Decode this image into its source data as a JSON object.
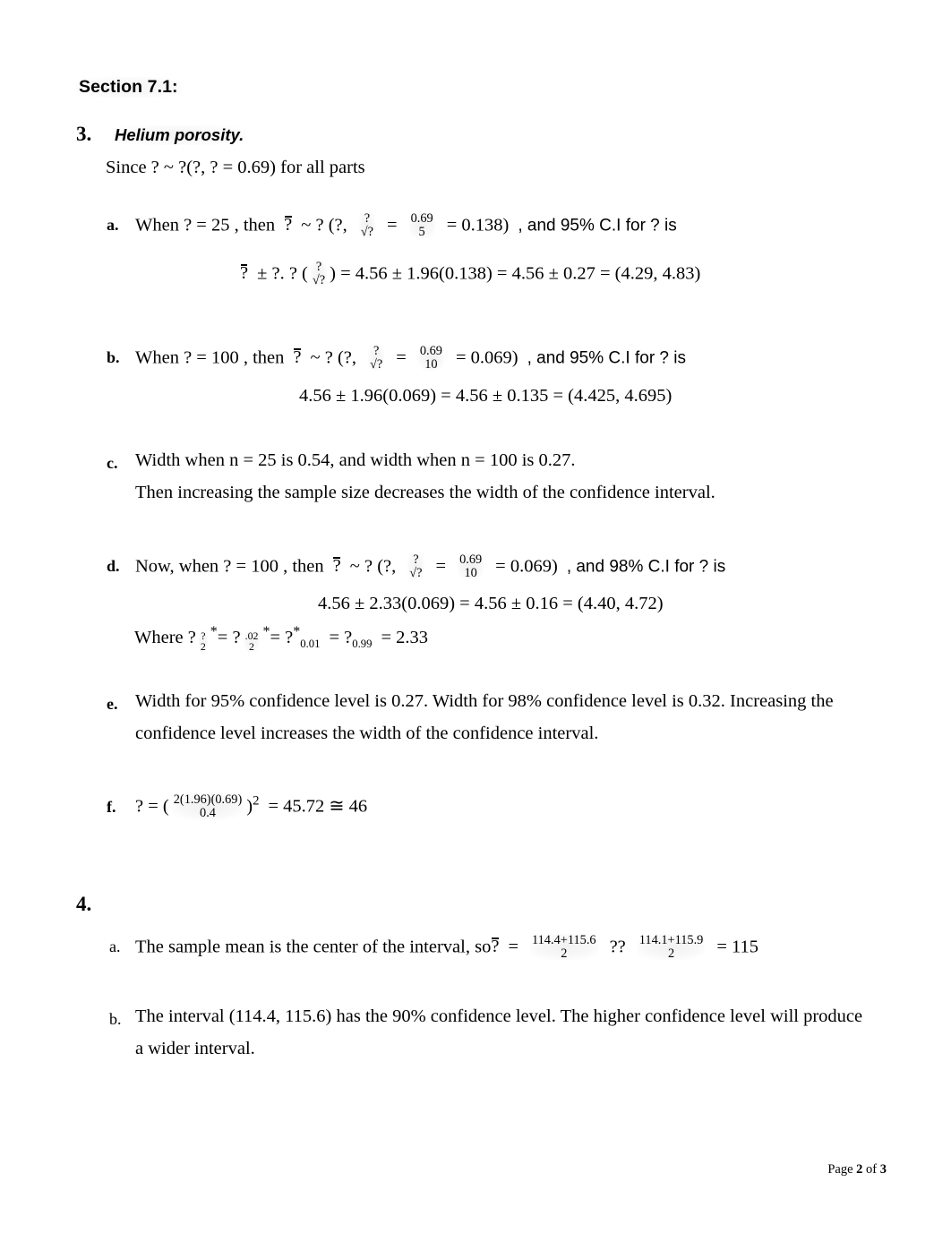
{
  "document": {
    "section_heading": "Section 7.1:",
    "footer": {
      "prefix": "Page ",
      "current_page": "2",
      "middle": " of ",
      "total_pages": "3"
    }
  },
  "problem3": {
    "number": "3.",
    "title": "Helium porosity.",
    "given_line": "Since ? ~ ?(?,     ? = 0.69)    for all parts",
    "items": {
      "a": {
        "label": "a.",
        "line1_pre": "When ? = 25   , then",
        "line1_bar": "?",
        "line1_mid": "~ ? (?,",
        "frac1_num": "?",
        "frac1_den": "√?",
        "eq1": "=",
        "frac2_num": "0.69",
        "frac2_den": "5",
        "eq2": "= 0.138)",
        "line1_post": ", and 95% C.I for ? is",
        "line2_bar": "?",
        "line2_pre": "± ?. ? (",
        "frac3_num": "?",
        "frac3_den": "√?",
        "line2_post": ") = 4.56 ± 1.96(0.138) = 4.56 ± 0.27 = (4.29, 4.83)"
      },
      "b": {
        "label": "b.",
        "line1_pre": "When ? = 100   , then",
        "line1_bar": "?",
        "line1_mid": "~ ? (?,",
        "frac1_num": "?",
        "frac1_den": "√?",
        "eq1": "=",
        "frac2_num": "0.69",
        "frac2_den": "10",
        "eq2": "= 0.069)",
        "line1_post": ", and 95% C.I for ? is",
        "line2": "4.56 ± 1.96(0.069) = 4.56 ± 0.135 = (4.425, 4.695)"
      },
      "c": {
        "label": "c.",
        "line1": "Width when n = 25 is 0.54, and width when n = 100 is 0.27.",
        "line2": "Then increasing the sample size decreases the width of the confidence interval."
      },
      "d": {
        "label": "d.",
        "line1_pre": "Now, when   ? = 100   , then",
        "line1_bar": "?",
        "line1_mid": "~ ? (?,",
        "frac1_num": "?",
        "frac1_den": "√?",
        "eq1": "=",
        "frac2_num": "0.69",
        "frac2_den": "10",
        "eq2": "= 0.069)",
        "line1_post": ", and 98% C.I for ? is",
        "line2": "4.56 ± 2.33(0.069) = 4.56 ± 0.16 = (4.40, 4.72)",
        "where_pre": "Where ?",
        "where_star1": "*",
        "where_sub1_num": "?",
        "where_sub1_den": "2",
        "where_eq1": "=   ?",
        "where_star2": "*",
        "where_sub2_num": ".02",
        "where_sub2_den": "2",
        "where_eq2": "=   ?",
        "where_star3": "*",
        "where_sub3": "0.01",
        "where_eq3": "= ?",
        "where_sub4": "0.99",
        "where_eq4": "= 2.33"
      },
      "e": {
        "label": "e.",
        "line1": "Width for 95% confidence level is 0.27.  Width for 98% confidence level is 0.32.  Increasing the",
        "line2": "confidence level increases the width of the confidence interval."
      },
      "f": {
        "label": "f.",
        "pre": "? = (",
        "frac_num": "2(1.96)(0.69)",
        "frac_den": "0.4",
        "close": ")",
        "exponent": "2",
        "post": "= 45.72 ≅ 46"
      }
    }
  },
  "problem4": {
    "number": "4.",
    "items": {
      "a": {
        "label": "a.",
        "text_pre": "The sample mean is the center of the interval, so",
        "bar_var": "?",
        "eq1": "=",
        "frac1_num": "114.4+115.6",
        "frac1_den": "2",
        "mid": "??",
        "frac2_num": "114.1+115.9",
        "frac2_den": "2",
        "eq2": "= 115"
      },
      "b": {
        "label": "b.",
        "line1": "The interval (114.4, 115.6) has the 90% confidence level.  The higher confidence level will produce",
        "line2": "a wider interval."
      }
    }
  }
}
